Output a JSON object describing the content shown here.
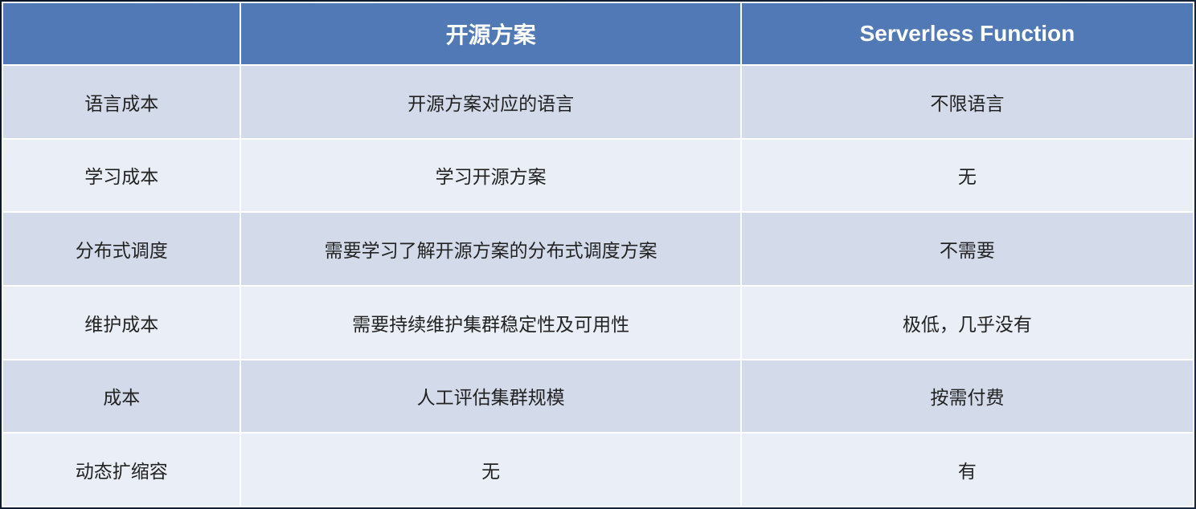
{
  "table": {
    "headers": [
      "",
      "开源方案",
      "Serverless Function"
    ],
    "rows": [
      {
        "label": "语言成本",
        "open_source": "开源方案对应的语言",
        "serverless": "不限语言"
      },
      {
        "label": "学习成本",
        "open_source": "学习开源方案",
        "serverless": "无"
      },
      {
        "label": "分布式调度",
        "open_source": "需要学习了解开源方案的分布式调度方案",
        "serverless": "不需要"
      },
      {
        "label": "维护成本",
        "open_source": "需要持续维护集群稳定性及可用性",
        "serverless": "极低，几乎没有"
      },
      {
        "label": "成本",
        "open_source": "人工评估集群规模",
        "serverless": "按需付费"
      },
      {
        "label": "动态扩缩容",
        "open_source": "无",
        "serverless": "有"
      }
    ]
  }
}
